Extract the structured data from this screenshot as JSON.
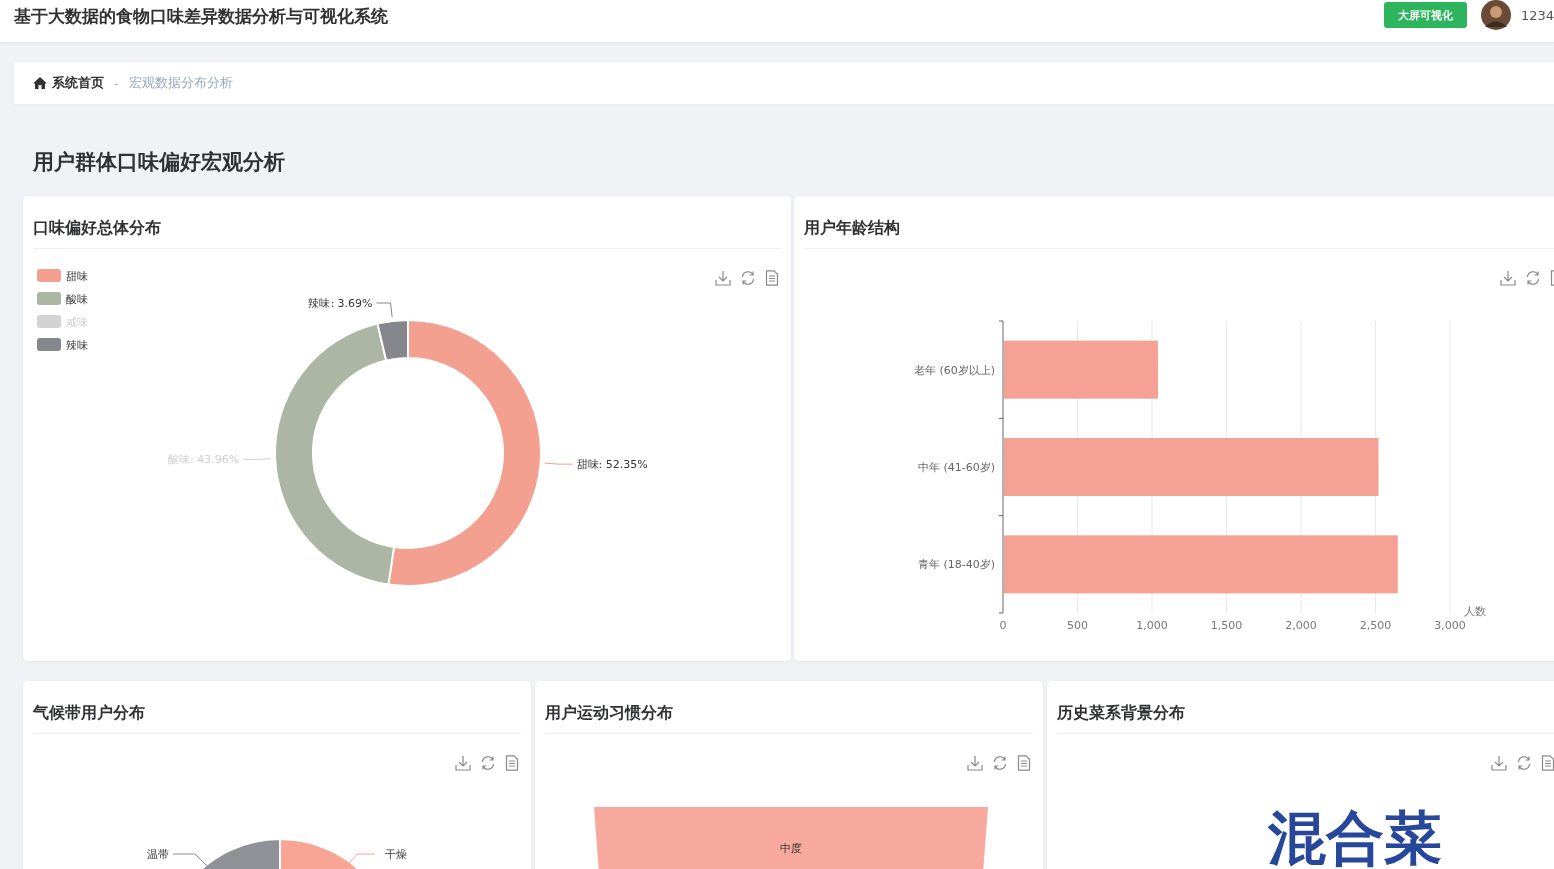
{
  "header": {
    "title": "基于大数据的食物口味差异数据分析与可视化系统",
    "screen_button": "大屏可视化",
    "user_name": "1234"
  },
  "breadcrumb": [
    {
      "label": "系统首页",
      "kind": "home"
    },
    {
      "label": "宏观数据分布分析",
      "kind": "current"
    }
  ],
  "breadcrumb_separator": "-",
  "page_title": "用户群体口味偏好宏观分析",
  "taste_card": {
    "title": "口味偏好总体分布",
    "legend": [
      {
        "color": "#f4a090",
        "selected": true,
        "slice_label": "甜味: 52.35%",
        "label_faded": false
      },
      {
        "color": "#adb5a4",
        "selected": true,
        "slice_label": "酸味: 43.96%",
        "label_faded": true
      },
      {
        "color": "#d3d3d3",
        "selected": false
      },
      {
        "color": "#86878c",
        "selected": true,
        "slice_label": "辣味: 3.69%",
        "label_faded": false
      }
    ],
    "chart_data": {
      "type": "donut",
      "legend": "top-left",
      "categories": [
        "甜味",
        "酸味",
        "咸味",
        "辣味"
      ],
      "values": [
        52.35,
        43.96,
        0,
        3.69
      ]
    }
  },
  "age_card": {
    "title": "用户年龄结构",
    "chart_data": {
      "type": "bar",
      "orientation": "horizontal",
      "categories": [
        "老年 (60岁以上)",
        "中年 (41-60岁)",
        "青年 (18-40岁)"
      ],
      "series": [
        {
          "color": "#f6a195",
          "values": [
            1040,
            2520,
            2650
          ]
        }
      ],
      "xlabel": "人数",
      "grid": true,
      "xlim": [
        0,
        3000
      ],
      "xticks": [
        0,
        500,
        {
          "value": 1000,
          "label": "1,000"
        },
        {
          "value": 1500,
          "label": "1,500"
        },
        {
          "value": 2000,
          "label": "2,000"
        },
        {
          "value": 2500,
          "label": "2,500"
        },
        {
          "value": 3000,
          "label": "3,000"
        }
      ]
    }
  },
  "climate_card": {
    "title": "气候带用户分布",
    "labels": [
      {
        "text": "温带",
        "color": "#919297"
      },
      {
        "text": "干燥",
        "color": "#f8a596"
      }
    ]
  },
  "exercise_card": {
    "title": "用户运动习惯分布",
    "funnel_label": "中度"
  },
  "cuisine_card": {
    "title": "历史菜系背景分布",
    "words": [
      "混合菜"
    ]
  }
}
